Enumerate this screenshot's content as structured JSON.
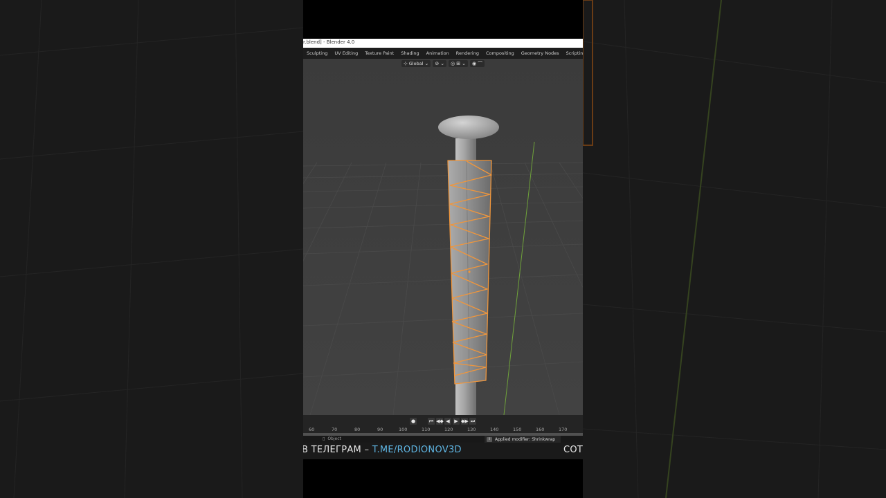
{
  "window": {
    "title": "r.blend] - Blender 4.0"
  },
  "workspace_tabs": [
    "Sculpting",
    "UV Editing",
    "Texture Paint",
    "Shading",
    "Animation",
    "Rendering",
    "Compositing",
    "Geometry Nodes",
    "Scripting"
  ],
  "workspace_add_label": "+",
  "viewport_header": {
    "orientation_icon": "transform-orientation-icon",
    "orientation_label": "Global",
    "pivot_icon": "pivot-point-icon",
    "snap_icon": "snap-magnet-icon",
    "snap_increment_icon": "snap-increment-icon",
    "proportional_icon": "proportional-editing-icon",
    "falloff_icon": "falloff-curve-icon",
    "chevron": "⌄"
  },
  "timeline": {
    "record_icon": "●",
    "transport": [
      "⏮",
      "◀◆",
      "◀",
      "▶",
      "◆▶",
      "⏭"
    ],
    "ruler_ticks": [
      "60",
      "70",
      "80",
      "90",
      "100",
      "110",
      "120",
      "130",
      "140",
      "150",
      "160",
      "170"
    ]
  },
  "status_bar": {
    "mode_icon": "mouse-icon",
    "mode_label": "Object",
    "message_icon": "i",
    "message": "Applied modifier: Shrinkwrap"
  },
  "caption": {
    "left_text": "В ТЕЛЕГРАМ – ",
    "link_text": "T.ME/RODIONOV3D",
    "right_text": "СОТ"
  },
  "colors": {
    "selection_outline": "#f0963c",
    "viewport_bg": "#3d3d3d",
    "y_axis": "#6fa33a",
    "caption_link": "#5fb6e4"
  }
}
